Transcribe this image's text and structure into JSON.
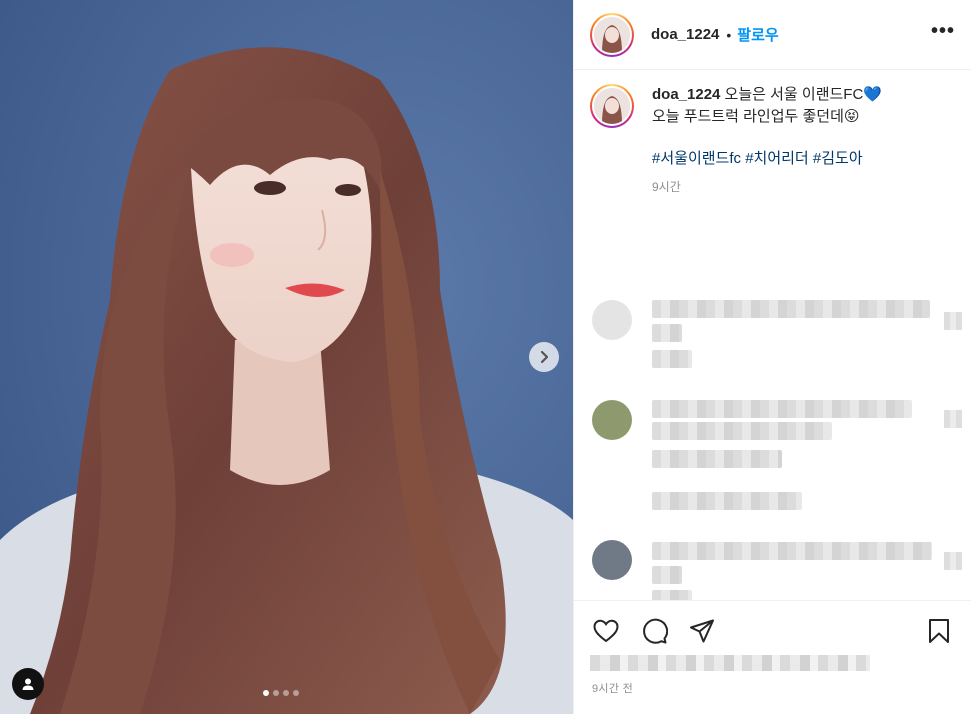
{
  "post": {
    "username": "doa_1224",
    "separator": "•",
    "follow_label": "팔로우",
    "more_label": "•••",
    "caption_line1": " 오늘은 서울 이랜드FC💙",
    "caption_line2": "오늘 푸드트럭 라인업두 좋던데😝",
    "hashtags": [
      "#서울이랜드fc",
      "#치어리더",
      "#김도아"
    ],
    "caption_time": "9시간",
    "post_time": "9시간 전"
  },
  "media": {
    "carousel_count": 4,
    "active_index": 0,
    "next_icon": "chevron-right-icon",
    "tag_icon": "user-tag-icon"
  },
  "actions": {
    "icons": [
      "heart-icon",
      "comment-icon",
      "share-icon",
      "bookmark-icon"
    ]
  },
  "colors": {
    "accent": "#0095f6",
    "hashtag": "#00376b",
    "muted": "#8e8e8e",
    "photo_background": "#48679a"
  }
}
